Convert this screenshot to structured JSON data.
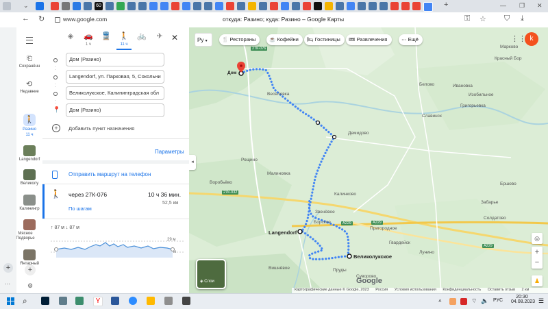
{
  "browser": {
    "address": "www.google.com",
    "page_title": "откуда: Разино; куда: Разино – Google Карты",
    "tab_icon_text": "60"
  },
  "rail": {
    "menu_label": "menu",
    "saved": "Сохранённ",
    "recent": "Недавние",
    "active_label": "Разино",
    "active_time": "11 ч",
    "items": [
      "Langendorf",
      "Великолу",
      "Калинингр",
      "Мясное Подворье",
      "Янтарный"
    ]
  },
  "panel": {
    "modes": [
      {
        "name": "best",
        "sub": ""
      },
      {
        "name": "car",
        "sub": "1 ч"
      },
      {
        "name": "transit",
        "sub": ""
      },
      {
        "name": "walk",
        "sub": "11 ч"
      },
      {
        "name": "bike",
        "sub": ""
      },
      {
        "name": "flight",
        "sub": ""
      }
    ],
    "fields": [
      "Дом (Разино)",
      "Langendorf, ул. Парковая, 5, Сокольни",
      "Великолукское, Калининградская обл",
      "Дом (Разино)"
    ],
    "add_destination": "Добавить пункт назначения",
    "params": "Параметры",
    "send_to_phone": "Отправить маршрут на телефон",
    "route": {
      "via": "через 27К-076",
      "time": "10 ч 36 мин.",
      "distance": "52,5 км",
      "steps": "По шагам"
    },
    "elevation": {
      "summary": "↑ 87 м  ↓ 87 м",
      "max": "29 м",
      "min": "7 м"
    }
  },
  "map": {
    "lang": "Ру",
    "chips": [
      "Рестораны",
      "Кофейни",
      "Гостиницы",
      "Развлечения",
      "Ещё"
    ],
    "avatar": "k",
    "layers": "Слои",
    "logo": "Google",
    "labels": {
      "dom": "Дом",
      "langendorf": "Langendorf",
      "velikoluk": "Великолукское",
      "markovo": "Марково",
      "krasny": "Красный Бор",
      "belovo": "Белово",
      "ivanovka": "Ивановка",
      "izobilnoe": "Изобильное",
      "grigorevka": "Григорьевка",
      "slavinsk": "Славинск",
      "demidovo": "Демидово",
      "voskresen": "Воскресенское",
      "veselovka": "Весёловка",
      "roshino": "Рощино",
      "vorobevo": "Воробьёво",
      "malinovka": "Малиновка",
      "kalinkovo": "Калинково",
      "zhukovo": "Жуково",
      "solnechnoe": "Солнечное",
      "ershovo": "Ершово",
      "zabare": "Забарье",
      "soldatovo": "Солдатово",
      "prigorodnoe": "Пригородное",
      "gvardeisk": "Гвардейск",
      "zvenevoe": "Звенёвое",
      "borskoe": "Борское",
      "lunino": "Лунино",
      "vishnevoe": "Вишнёвое",
      "ozerovo": "Озерово",
      "prudy": "Пруды",
      "suvorovo": "Суворово",
      "razino": "Разино"
    },
    "roads": [
      "27К-076",
      "27К-032",
      "А229",
      "А229",
      "А229"
    ],
    "footer": [
      "Картографические данные © Google, 2023",
      "Россия",
      "Условия использования",
      "Конфиденциальность",
      "Оставить отзыв",
      "2 км"
    ]
  },
  "taskbar": {
    "lang": "РУС",
    "time": "20:30",
    "date": "04.08.2023"
  }
}
